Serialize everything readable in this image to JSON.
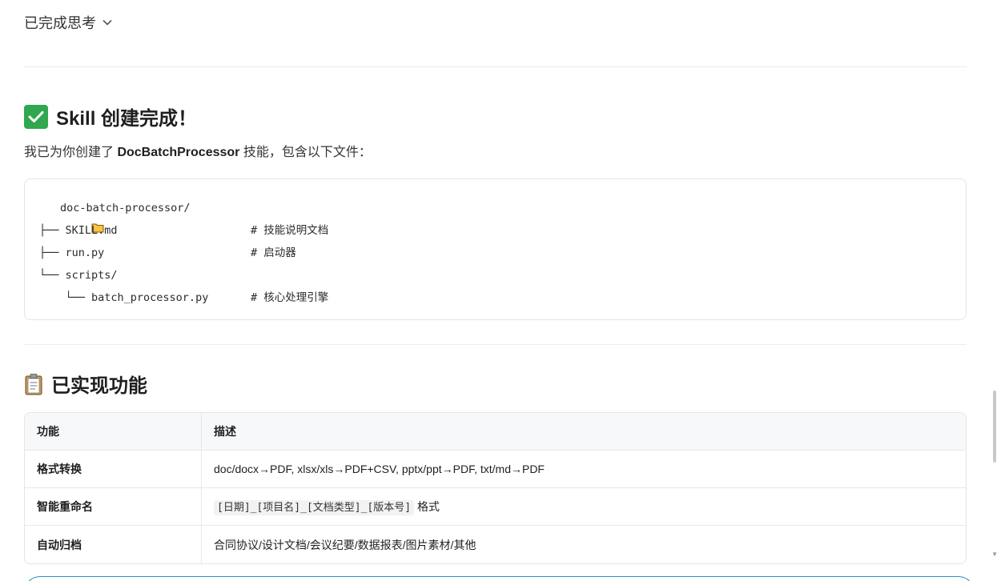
{
  "thinking": {
    "label": "已完成思考"
  },
  "heading1": {
    "icon": "check-mark-icon",
    "text": "Skill 创建完成！"
  },
  "intro": {
    "prefix": "我已为你创建了 ",
    "name": "DocBatchProcessor",
    "suffix": " 技能，包含以下文件："
  },
  "tree": [
    {
      "text": "doc-batch-processor/",
      "comment": ""
    },
    {
      "text": "├── SKILL.md",
      "comment": "# 技能说明文档"
    },
    {
      "text": "├── run.py",
      "comment": "# 启动器"
    },
    {
      "text": "└── scripts/",
      "comment": ""
    },
    {
      "text": "    └── batch_processor.py",
      "comment": "# 核心处理引擎"
    }
  ],
  "heading2": {
    "icon": "clipboard-icon",
    "text": "已实现功能"
  },
  "table": {
    "headers": [
      "功能",
      "描述"
    ],
    "rows": [
      {
        "feature": "格式转换",
        "desc": "doc/docx→PDF, xlsx/xls→PDF+CSV, pptx/ppt→PDF, txt/md→PDF"
      },
      {
        "feature": "智能重命名",
        "code": "[日期]_[项目名]_[文档类型]_[版本号]",
        "desc": " 格式"
      },
      {
        "feature": "自动归档",
        "desc": "合同协议/设计文档/会议纪要/数据报表/图片素材/其他"
      }
    ]
  }
}
